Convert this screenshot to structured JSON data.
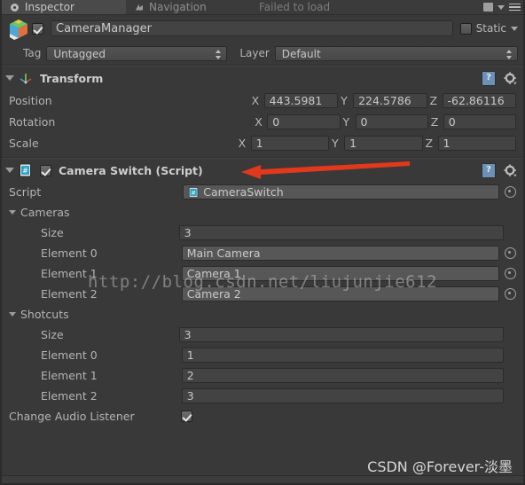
{
  "window": {
    "tabs": [
      {
        "label": "Inspector",
        "icon": "inspector-icon",
        "active": true
      },
      {
        "label": "Navigation",
        "icon": "navigation-icon",
        "active": false
      },
      {
        "label": "Failed to load",
        "icon": "",
        "active": false
      }
    ],
    "lock_icon": "lock-icon",
    "menu_icon": "hamburger-menu-icon"
  },
  "object_header": {
    "icon": "gameobject-cube-icon",
    "enabled_checkbox": "checked",
    "name": "CameraManager",
    "static_label": "Static",
    "static_checked": false,
    "static_dropdown_icon": "chevron-down-icon"
  },
  "tag_layer": {
    "tag_label": "Tag",
    "tag_value": "Untagged",
    "layer_label": "Layer",
    "layer_value": "Default"
  },
  "transform": {
    "title": "Transform",
    "icon": "transform-axis-icon",
    "help_icon": "help-book-icon",
    "help_glyph": "?",
    "gear_icon": "settings-gear-icon",
    "rows": [
      {
        "label": "Position",
        "x": "443.5981",
        "y": "224.5786",
        "z": "-62.86116"
      },
      {
        "label": "Rotation",
        "x": "0",
        "y": "0",
        "z": "0"
      },
      {
        "label": "Scale",
        "x": "1",
        "y": "1",
        "z": "1"
      }
    ],
    "axis_x": "X",
    "axis_y": "Y",
    "axis_z": "Z"
  },
  "camera_switch": {
    "title": "Camera Switch (Script)",
    "icon": "csharp-script-icon",
    "enabled_checkbox": "checked",
    "help_icon": "help-book-icon",
    "help_glyph": "?",
    "gear_icon": "settings-gear-icon",
    "script_row": {
      "label": "Script",
      "value": "CameraSwitch",
      "icon": "csharp-script-icon",
      "picker_icon": "object-picker-icon"
    },
    "cameras": {
      "label": "Cameras",
      "size_label": "Size",
      "size_value": "3",
      "elements": [
        {
          "label": "Element 0",
          "value": "Main Camera"
        },
        {
          "label": "Element 1",
          "value": "Camera 1"
        },
        {
          "label": "Element 2",
          "value": "Camera 2"
        }
      ]
    },
    "shotcuts": {
      "label": "Shotcuts",
      "size_label": "Size",
      "size_value": "3",
      "elements": [
        {
          "label": "Element 0",
          "value": "1"
        },
        {
          "label": "Element 1",
          "value": "2"
        },
        {
          "label": "Element 2",
          "value": "3"
        }
      ]
    },
    "change_audio_listener": {
      "label": "Change Audio Listener",
      "checked": true
    }
  },
  "annotations": {
    "arrow": {
      "name": "red-arrow-annotation",
      "color": "#e0391c",
      "direction": "left"
    },
    "watermark_url": "http://blog.csdn.net/liujunjie612",
    "watermark_author": "CSDN @Forever-淡墨"
  },
  "colors": {
    "background": "#393939",
    "field": "#434343",
    "object_field": "#575757",
    "accent_help": "#6d91b5",
    "arrow": "#e0391c"
  }
}
